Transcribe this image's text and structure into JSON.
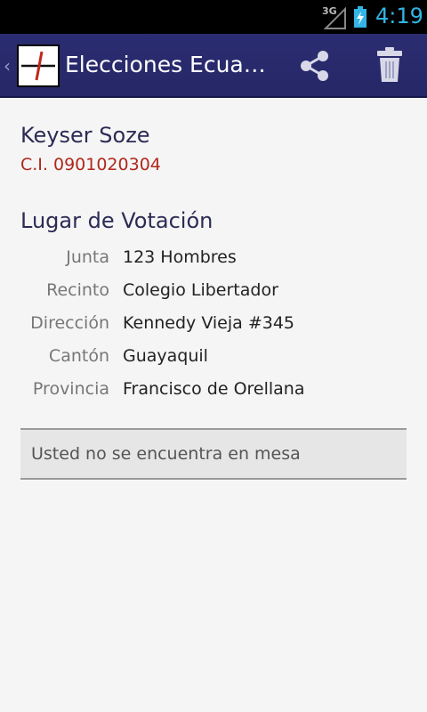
{
  "status_bar": {
    "network_label": "3G",
    "time": "4:19",
    "accent_color": "#33b5e5"
  },
  "action_bar": {
    "title": "Elecciones Ecua…",
    "background_color": "#2b2d72",
    "icons": [
      "up-caret",
      "app-logo",
      "share-icon",
      "trash-icon"
    ]
  },
  "voter": {
    "name": "Keyser Soze",
    "ci": "C.I. 0901020304"
  },
  "voting_place": {
    "title": "Lugar de Votación",
    "rows": [
      {
        "label": "Junta",
        "value": "123 Hombres"
      },
      {
        "label": "Recinto",
        "value": "Colegio Libertador"
      },
      {
        "label": "Dirección",
        "value": "Kennedy Vieja #345"
      },
      {
        "label": "Cantón",
        "value": "Guayaquil"
      },
      {
        "label": "Provincia",
        "value": "Francisco de Orellana"
      }
    ]
  },
  "mesa_status": "Usted no se encuentra en mesa"
}
